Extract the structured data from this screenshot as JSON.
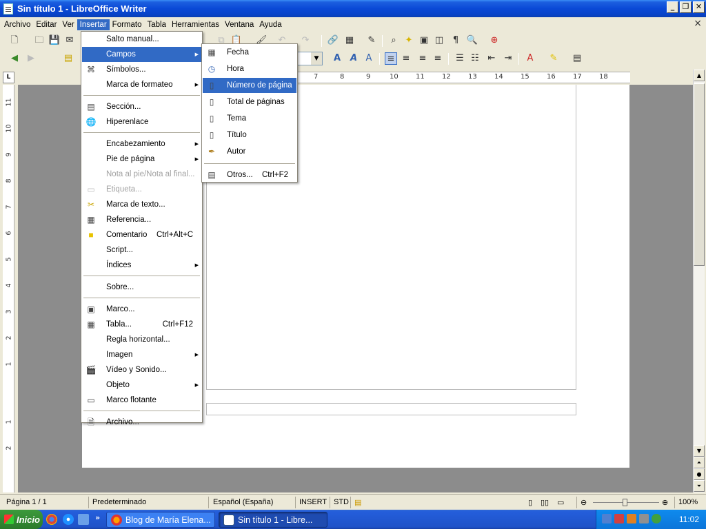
{
  "window": {
    "title": "Sin título 1 - LibreOffice Writer",
    "min": "_",
    "max": "❐",
    "close": "✕"
  },
  "menubar": {
    "items": [
      "Archivo",
      "Editar",
      "Ver",
      "Insertar",
      "Formato",
      "Tabla",
      "Herramientas",
      "Ventana",
      "Ayuda"
    ],
    "active": "Insertar",
    "close_doc": "×"
  },
  "ruler": {
    "corner": "L",
    "h_ticks": [
      "7",
      "8",
      "9",
      "10",
      "11",
      "12",
      "13",
      "14",
      "15",
      "16",
      "17",
      "18"
    ],
    "v_ticks": [
      "11",
      "10",
      "9",
      "8",
      "7",
      "6",
      "5",
      "4",
      "3",
      "2",
      "1",
      "1",
      "2"
    ]
  },
  "insert_menu": {
    "items": [
      {
        "label": "Salto manual...",
        "icon": "",
        "acc": "",
        "sub": false,
        "disabled": false
      },
      {
        "label": "Campos",
        "icon": "",
        "acc": "",
        "sub": true,
        "disabled": false,
        "highlight": true
      },
      {
        "label": "Símbolos...",
        "icon": "omega-icon",
        "acc": "",
        "sub": false,
        "disabled": false
      },
      {
        "label": "Marca de formateo",
        "icon": "",
        "acc": "",
        "sub": true,
        "disabled": false
      },
      {
        "sep": true
      },
      {
        "label": "Sección...",
        "icon": "section-icon",
        "acc": "",
        "sub": false,
        "disabled": false
      },
      {
        "label": "Hiperenlace",
        "icon": "hyperlink-icon",
        "acc": "",
        "sub": false,
        "disabled": false
      },
      {
        "sep": true
      },
      {
        "label": "Encabezamiento",
        "icon": "",
        "acc": "",
        "sub": true,
        "disabled": false
      },
      {
        "label": "Pie de página",
        "icon": "",
        "acc": "",
        "sub": true,
        "disabled": false
      },
      {
        "label": "Nota al pie/Nota al final...",
        "icon": "",
        "acc": "",
        "sub": false,
        "disabled": true
      },
      {
        "label": "Etiqueta...",
        "icon": "caption-icon",
        "acc": "",
        "sub": false,
        "disabled": true
      },
      {
        "label": "Marca de texto...",
        "icon": "bookmark-icon",
        "acc": "",
        "sub": false,
        "disabled": false
      },
      {
        "label": "Referencia...",
        "icon": "reference-icon",
        "acc": "",
        "sub": false,
        "disabled": false
      },
      {
        "label": "Comentario",
        "icon": "comment-icon",
        "acc": "Ctrl+Alt+C",
        "sub": false,
        "disabled": false
      },
      {
        "label": "Script...",
        "icon": "",
        "acc": "",
        "sub": false,
        "disabled": false
      },
      {
        "label": "Índices",
        "icon": "",
        "acc": "",
        "sub": true,
        "disabled": false
      },
      {
        "sep": true
      },
      {
        "label": "Sobre...",
        "icon": "",
        "acc": "",
        "sub": false,
        "disabled": false
      },
      {
        "sep": true
      },
      {
        "label": "Marco...",
        "icon": "frame-icon",
        "acc": "",
        "sub": false,
        "disabled": false
      },
      {
        "label": "Tabla...",
        "icon": "table-icon",
        "acc": "Ctrl+F12",
        "sub": false,
        "disabled": false
      },
      {
        "label": "Regla horizontal...",
        "icon": "",
        "acc": "",
        "sub": false,
        "disabled": false
      },
      {
        "label": "Imagen",
        "icon": "",
        "acc": "",
        "sub": true,
        "disabled": false
      },
      {
        "label": "Vídeo y Sonido...",
        "icon": "media-icon",
        "acc": "",
        "sub": false,
        "disabled": false
      },
      {
        "label": "Objeto",
        "icon": "",
        "acc": "",
        "sub": true,
        "disabled": false
      },
      {
        "label": "Marco flotante",
        "icon": "floating-frame-icon",
        "acc": "",
        "sub": false,
        "disabled": false
      },
      {
        "sep": true
      },
      {
        "label": "Archivo...",
        "icon": "file-icon",
        "acc": "",
        "sub": false,
        "disabled": false
      }
    ]
  },
  "fields_menu": {
    "items": [
      {
        "label": "Fecha",
        "icon": "calendar-icon",
        "acc": ""
      },
      {
        "label": "Hora",
        "icon": "clock-icon",
        "acc": ""
      },
      {
        "label": "Número de página",
        "icon": "page-number-icon",
        "acc": "",
        "highlight": true
      },
      {
        "label": "Total de páginas",
        "icon": "page-count-icon",
        "acc": ""
      },
      {
        "label": "Tema",
        "icon": "subject-icon",
        "acc": ""
      },
      {
        "label": "Título",
        "icon": "title-icon",
        "acc": ""
      },
      {
        "label": "Autor",
        "icon": "author-icon",
        "acc": ""
      },
      {
        "sep": true
      },
      {
        "label": "Otros...",
        "icon": "fields-icon",
        "acc": "Ctrl+F2"
      }
    ]
  },
  "status": {
    "page": "Página 1 / 1",
    "style": "Predeterminado",
    "language": "Español (España)",
    "mode": "INSERT",
    "selection": "STD",
    "zoom": "100%"
  },
  "taskbar": {
    "start": "Inicio",
    "quick_more": "»",
    "tasks": [
      {
        "label": "Blog de María Elena...",
        "active": false
      },
      {
        "label": "Sin título 1 - Libre...",
        "active": true
      }
    ],
    "clock": "11:02"
  },
  "colors": {
    "menu_highlight": "#316AC5",
    "titlebar": "#0A49D6",
    "taskbar": "#245EDB"
  }
}
